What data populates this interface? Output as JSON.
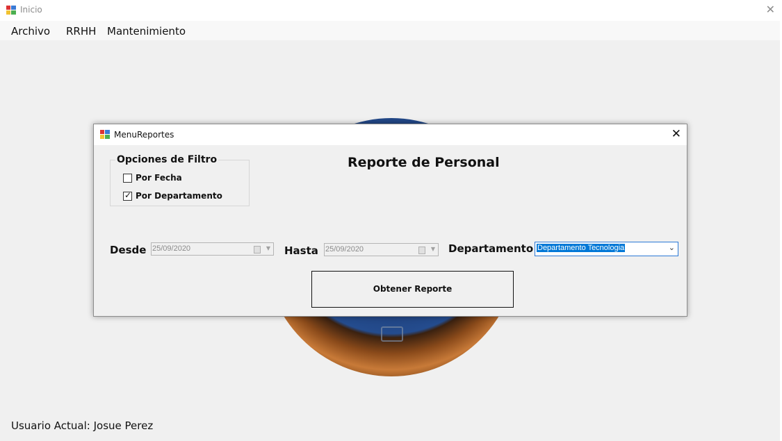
{
  "window": {
    "title": "Inicio",
    "close_glyph": "✕"
  },
  "menubar": {
    "items": [
      "Archivo",
      "RRHH",
      "Mantenimiento"
    ]
  },
  "status": {
    "label": "Usuario Actual:",
    "user": "Josue Perez"
  },
  "dialog": {
    "title": "MenuReportes",
    "close_glyph": "✕",
    "heading": "Reporte de Personal",
    "filter_group": {
      "legend": "Opciones de Filtro",
      "options": [
        {
          "label": "Por Fecha",
          "checked": false
        },
        {
          "label": "Por Departamento",
          "checked": true
        }
      ]
    },
    "desde": {
      "label": "Desde",
      "value": "25/09/2020"
    },
    "hasta": {
      "label": "Hasta",
      "value": "25/09/2020"
    },
    "departamento": {
      "label": "Departamento",
      "value": "Departamento Tecnologia"
    },
    "submit_label": "Obtener Reporte"
  },
  "icons": {
    "window": "app-icon",
    "close": "close-icon",
    "calendar": "calendar-icon",
    "dropdown": "chevron-down-icon"
  },
  "colors": {
    "selection": "#0078d7",
    "focus_border": "#2a78d6"
  }
}
